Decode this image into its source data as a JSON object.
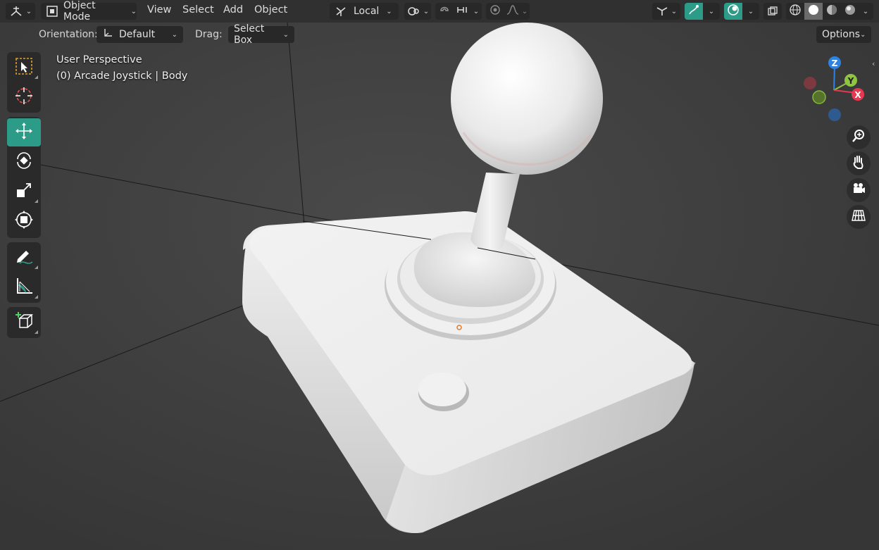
{
  "header": {
    "editor_type_icon": "viewport-3d-icon",
    "mode": {
      "icon": "object-mode-icon",
      "label": "Object Mode"
    },
    "menus": [
      "View",
      "Select",
      "Add",
      "Object"
    ],
    "transform_orientation": {
      "icon": "local-orientation-icon",
      "label": "Local"
    },
    "pivot_icon": "pivot-point-icon",
    "snap_icon": "magnet-snap-icon",
    "snap_target_icon": "snap-increment-icon",
    "proportional_icon": "proportional-edit-icon",
    "falloff_icon": "falloff-curve-icon",
    "show_gizmo_icon": "show-gizmo-icon",
    "overlay_icon": "overlays-icon",
    "xray_icon": "xray-icon",
    "shading_modes": [
      "wireframe",
      "solid",
      "material-preview",
      "rendered"
    ],
    "active_shading": "solid"
  },
  "tool_settings": {
    "orientation_label": "Orientation:",
    "orientation_value": "Default",
    "drag_label": "Drag:",
    "drag_value": "Select Box",
    "options_label": "Options"
  },
  "toolbar": {
    "tools": [
      {
        "name": "select-box",
        "icon": "select-box-icon",
        "active": false
      },
      {
        "name": "cursor",
        "icon": "cursor-3d-icon",
        "active": false
      },
      {
        "name": "move",
        "icon": "move-icon",
        "active": true
      },
      {
        "name": "rotate",
        "icon": "rotate-icon",
        "active": false
      },
      {
        "name": "scale",
        "icon": "scale-icon",
        "active": false
      },
      {
        "name": "transform",
        "icon": "transform-icon",
        "active": false
      },
      {
        "name": "annotate",
        "icon": "annotate-icon",
        "active": false
      },
      {
        "name": "measure",
        "icon": "measure-icon",
        "active": false
      },
      {
        "name": "add-cube",
        "icon": "add-cube-icon",
        "active": false
      }
    ]
  },
  "viewport": {
    "view_name": "User Perspective",
    "object_info": "(0) Arcade Joystick | Body"
  },
  "navigation_gizmo": {
    "axes": [
      "X",
      "Y",
      "Z"
    ],
    "colors": {
      "x": "#e8384f",
      "y": "#8ec63f",
      "z": "#2f83e0"
    }
  },
  "nav_buttons": [
    "zoom-icon",
    "hand-pan-icon",
    "camera-icon",
    "grid-ortho-icon"
  ],
  "colors": {
    "accent": "#2c9c88",
    "header_bg": "#303030",
    "button_bg": "#282828"
  }
}
